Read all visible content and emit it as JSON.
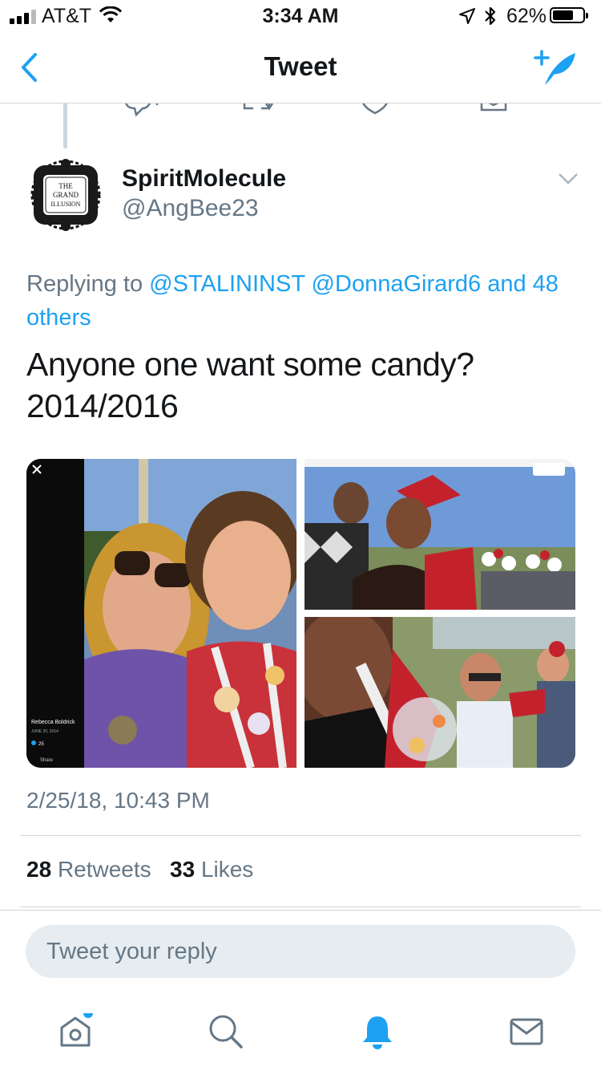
{
  "status_bar": {
    "carrier": "AT&T",
    "time": "3:34 AM",
    "battery_percent": "62%",
    "battery_level": 0.62
  },
  "nav": {
    "title": "Tweet",
    "back_icon": "chevron-left-icon",
    "compose_icon": "compose-tweet-icon"
  },
  "tweet": {
    "display_name": "SpiritMolecule",
    "handle": "@AngBee23",
    "avatar_text": [
      "THE",
      "GRAND",
      "ILLUSION"
    ],
    "replying_prefix": "Replying to",
    "replying_mentions": "@STALININST @DonnaGirard6 and 48 others",
    "text_line1": "Anyone one want some candy?",
    "text_line2": "2014/2016",
    "media": {
      "screenshot_user": "Rebecca Boldrick",
      "screenshot_date": "JUNE 20, 2014",
      "screenshot_count": "25",
      "screenshot_share": "Share"
    },
    "timestamp": "2/25/18, 10:43 PM",
    "retweets_count": "28",
    "retweets_label": "Retweets",
    "likes_count": "33",
    "likes_label": "Likes"
  },
  "reply": {
    "placeholder": "Tweet your reply"
  },
  "tab_bar": {
    "tabs": [
      "home-icon",
      "search-icon",
      "notifications-icon",
      "messages-icon"
    ],
    "active": "notifications-icon"
  },
  "colors": {
    "accent": "#1da1f2",
    "secondary_text": "#657786",
    "divider": "#d0d6db"
  }
}
